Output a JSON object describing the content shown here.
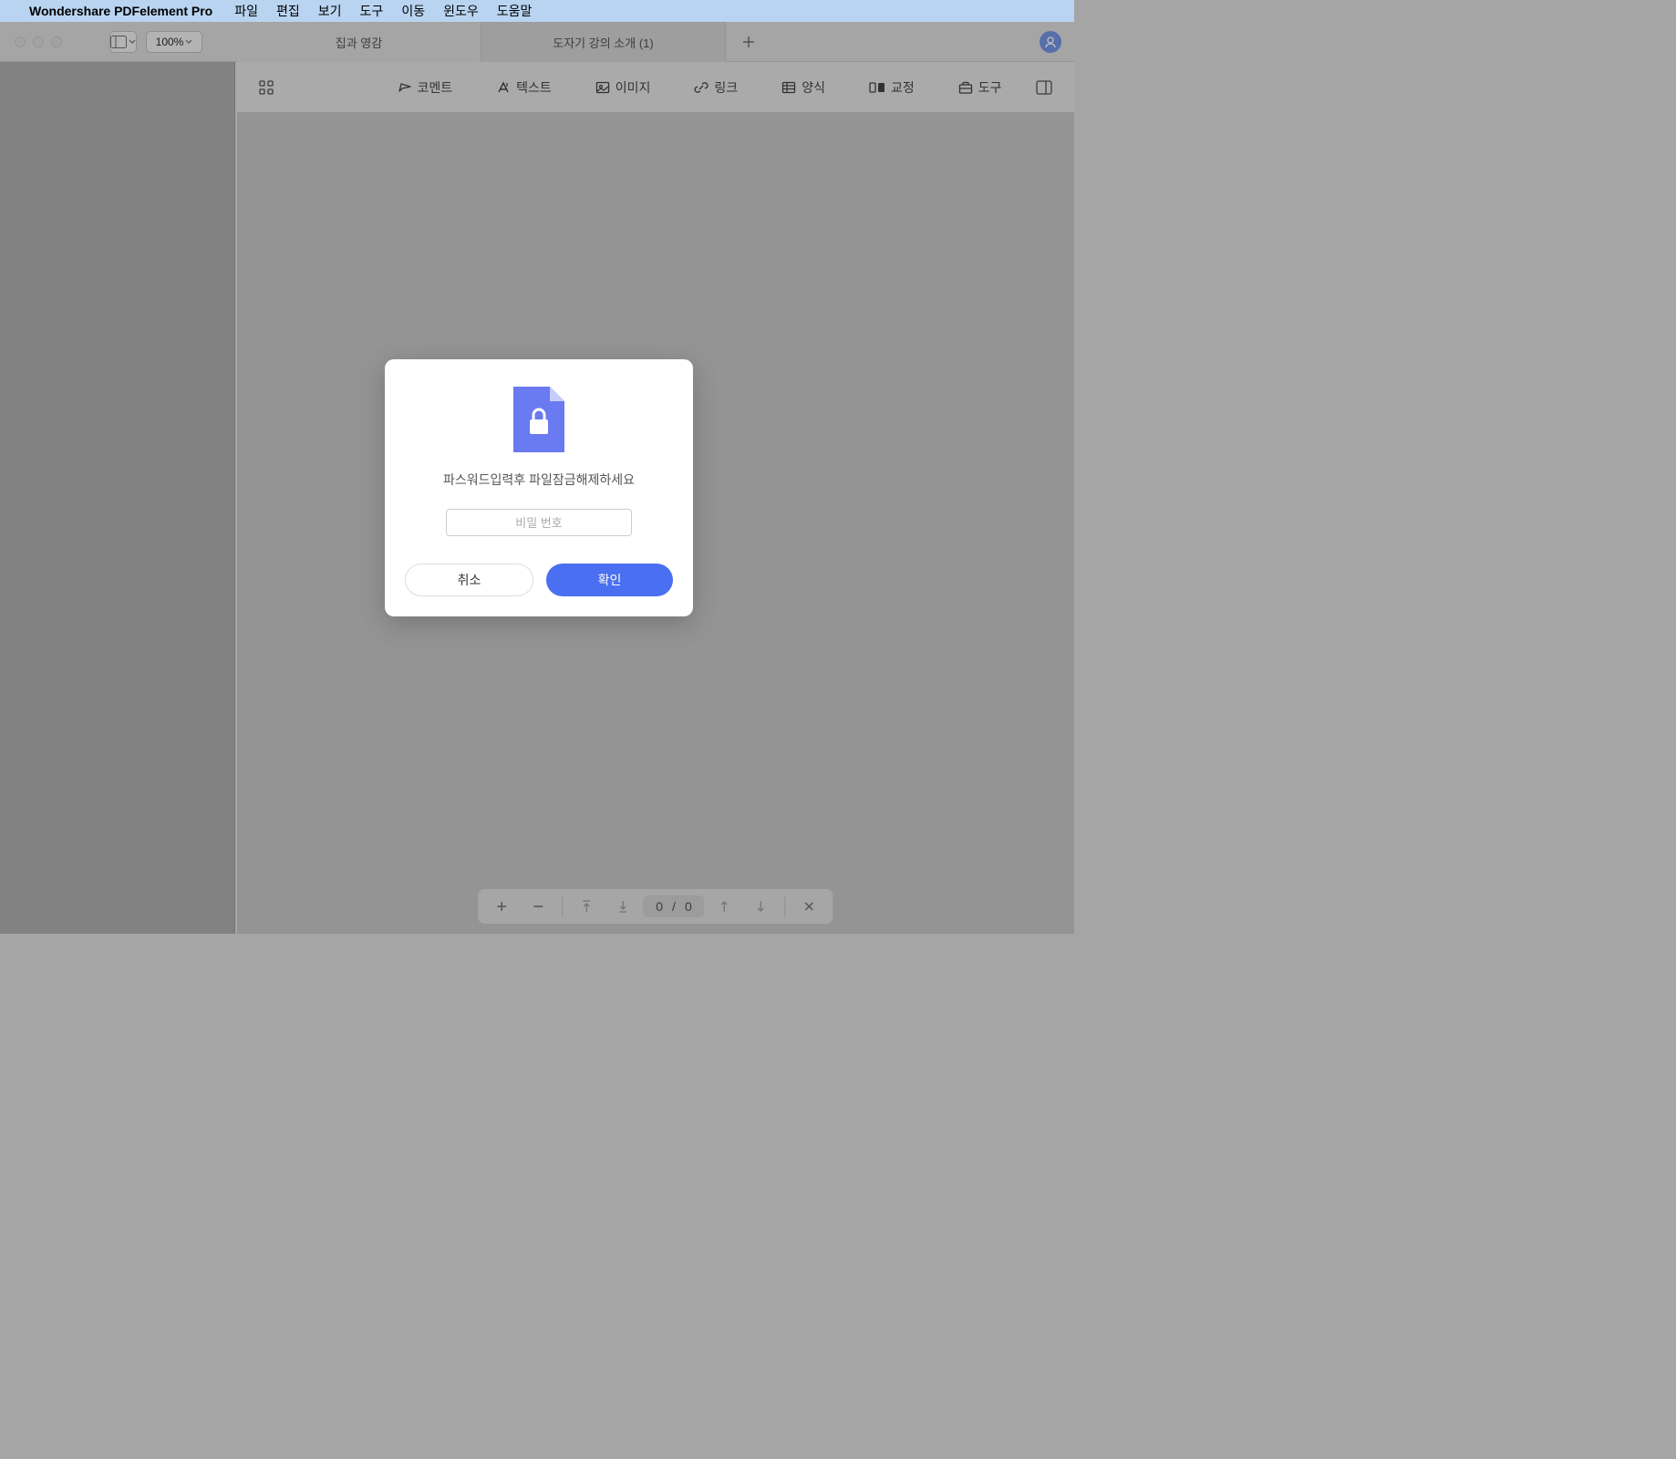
{
  "menubar": {
    "appname": "Wondershare PDFelement Pro",
    "items": [
      "파일",
      "편집",
      "보기",
      "도구",
      "이동",
      "윈도우",
      "도움말"
    ]
  },
  "titlebar": {
    "zoom": "100%",
    "tabs": [
      {
        "label": "집과 영감",
        "active": false
      },
      {
        "label": "도자기 강의 소개 (1)",
        "active": true
      }
    ]
  },
  "toolbar": {
    "items": [
      {
        "label": "코멘트",
        "icon": "comment"
      },
      {
        "label": "텍스트",
        "icon": "text"
      },
      {
        "label": "이미지",
        "icon": "image"
      },
      {
        "label": "링크",
        "icon": "link"
      },
      {
        "label": "양식",
        "icon": "form"
      },
      {
        "label": "교정",
        "icon": "redact"
      },
      {
        "label": "도구",
        "icon": "tools"
      }
    ]
  },
  "bottombar": {
    "current": "0",
    "sep": "/",
    "total": "0"
  },
  "dialog": {
    "message": "파스워드입력후 파일잠금해제하세요",
    "placeholder": "비밀 번호",
    "cancel": "취소",
    "ok": "확인"
  }
}
